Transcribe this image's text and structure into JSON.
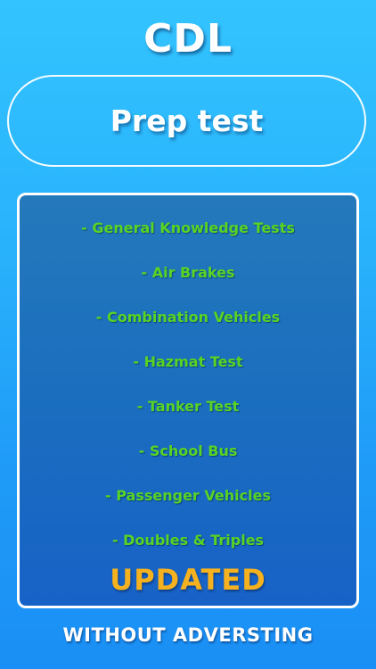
{
  "header": {
    "title": "CDL"
  },
  "prep": {
    "label": "Prep test"
  },
  "features": {
    "items": [
      "- General Knowledge Tests",
      "- Air Brakes",
      "- Combination Vehicles",
      "- Hazmat Test",
      "- Tanker Test",
      "- School Bus",
      "- Passenger Vehicles",
      "- Doubles & Triples"
    ],
    "updated_label": "UPDATED"
  },
  "footer": {
    "text": "WITHOUT ADVERSTING"
  },
  "colors": {
    "background_top": "#33c4ff",
    "background_bottom": "#1a8ff5",
    "panel": "#1b6fbe",
    "feature_text": "#58d424",
    "updated_text": "#f6b21e"
  }
}
